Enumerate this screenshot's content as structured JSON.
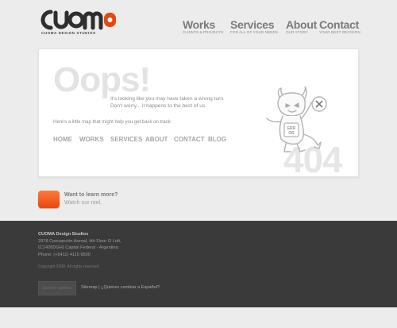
{
  "header": {
    "logo_tagline": "CUOMA DESIGN STUDIOS",
    "nav": [
      {
        "title": "Works",
        "sub": "CLIENTS & PROJECTS"
      },
      {
        "title": "Services",
        "sub": "FOR ALL OF YOUR NEEDS"
      },
      {
        "title": "About",
        "sub": "OUR STORY"
      },
      {
        "title": "Contact",
        "sub": "YOUR BEST DECISION"
      }
    ]
  },
  "error_card": {
    "heading": "Oops!",
    "message_line1": "It's looking like you may have taken a wrong turn.",
    "message_line2": "Don't worry... it happens to the best of us.",
    "map_text": "Here's a little map that might help you get back on track:",
    "links": [
      "HOME",
      "WORKS",
      "SERVICES",
      "ABOUT",
      "CONTACT",
      "BLOG"
    ],
    "code": "404",
    "mascot_sign": "ERR OR"
  },
  "reel": {
    "line1": "Want to learn more?",
    "line2": "Watch our reel."
  },
  "footer": {
    "company": "CUOMA Design Studios",
    "address_line1": "2978 Concepción Arenal, 4th Floor O Loft,",
    "address_line2": "(C1426DGH) Capital Federal - Argentina",
    "phone": "Phone: (+5411) 4115 6500",
    "copyright": "Copyright 2008. All rights reserved.",
    "language_button": "Quieres cambiar",
    "sitemap": "Sitemap",
    "separator": "|",
    "language_link": "¿Quieres cambiar a Español?"
  },
  "colors": {
    "accent": "#e54810",
    "footer_bg": "#3a3a3a",
    "page_bg": "#ececec"
  }
}
